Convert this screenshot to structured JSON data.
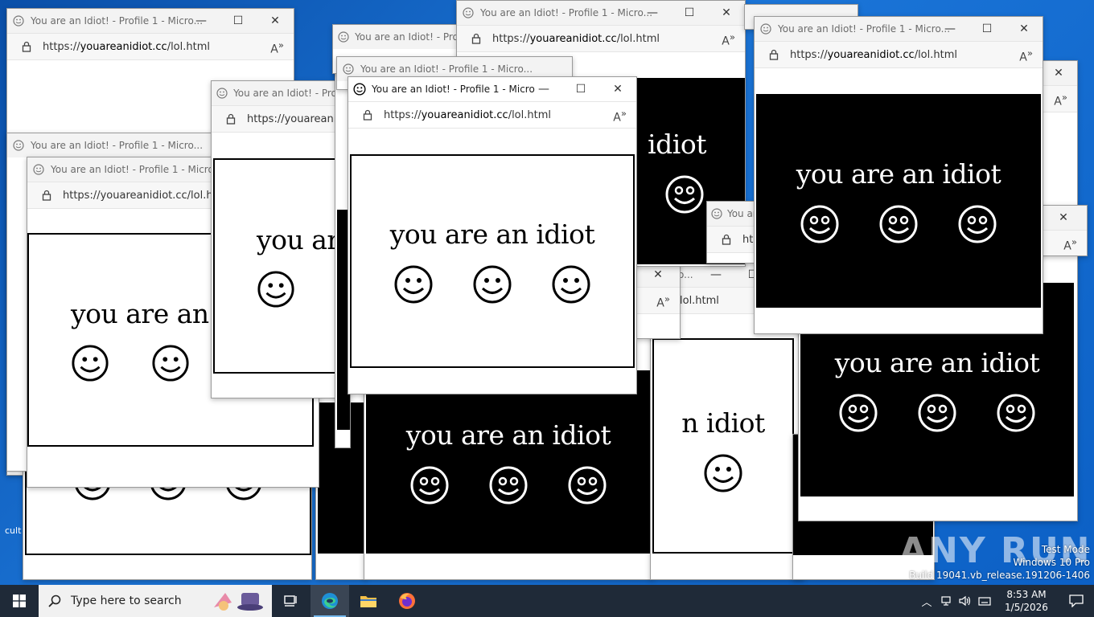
{
  "popup": {
    "title_full": "You are an Idiot! - Profile 1 - Micro...",
    "url_prefix": "https://",
    "url_host": "youareanidiot.cc",
    "url_path": "/lol.html",
    "message": "you are an idiot",
    "message_partial_1": "you are an",
    "message_partial_2": "you ar",
    "message_partial_3": "idiot",
    "message_partial_4": "n idiot",
    "url_partial": "lol.html",
    "title_partial_1": "You are an Idiot! - Profile",
    "title_partial_2": "You are",
    "title_partial_3": "o...",
    "url_partial_2": "https://youareani",
    "url_partial_3": "https://youareanidiot.cc/lol.ht",
    "url_partial_4": "ht",
    "title_partial_4": "You are an Idiot! - Profile 1 - Micro"
  },
  "window_controls": {
    "minimize": "—",
    "maximize": "☐",
    "close": "✕"
  },
  "desktop": {
    "icon_label_partial": "cult"
  },
  "taskbar": {
    "search_placeholder": "Type here to search",
    "apps": [
      "task-view",
      "edge",
      "file-explorer",
      "firefox"
    ],
    "time": "8:53 AM",
    "date": "1/5/2026"
  },
  "watermark": {
    "line1": "Test Mode",
    "line2": "Windows 10 Pro",
    "line3": "Build 19041.vb_release.191206-1406",
    "brand": "ANY RUN"
  },
  "colors": {
    "taskbar": "#1f2a38",
    "desktop": "#1b75d8",
    "accent": "#76b9ed"
  }
}
